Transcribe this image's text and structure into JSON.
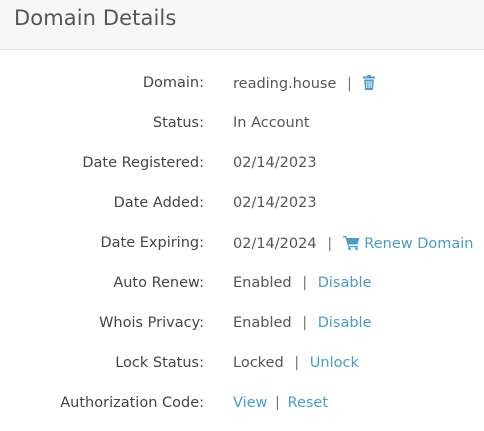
{
  "header": {
    "title": "Domain Details"
  },
  "rows": [
    {
      "label": "Domain:",
      "value": "reading.house",
      "sep": "|",
      "icon": "trash-icon"
    },
    {
      "label": "Status:",
      "value": "In Account"
    },
    {
      "label": "Date Registered:",
      "value": "02/14/2023"
    },
    {
      "label": "Date Added:",
      "value": "02/14/2023"
    },
    {
      "label": "Date Expiring:",
      "value": "02/14/2024",
      "sep": "|",
      "icon": "cart-icon",
      "action": "Renew Domain"
    },
    {
      "label": "Auto Renew:",
      "value": "Enabled",
      "sep": "|",
      "action": "Disable"
    },
    {
      "label": "Whois Privacy:",
      "value": "Enabled",
      "sep": "|",
      "action": "Disable"
    },
    {
      "label": "Lock Status:",
      "value": "Locked",
      "sep": "|",
      "action": "Unlock"
    },
    {
      "label": "Authorization Code:",
      "action": "View",
      "sep": "|",
      "action2": "Reset"
    }
  ],
  "colors": {
    "accent": "#4a9cc4",
    "header_bg": "#f7f7f7"
  }
}
